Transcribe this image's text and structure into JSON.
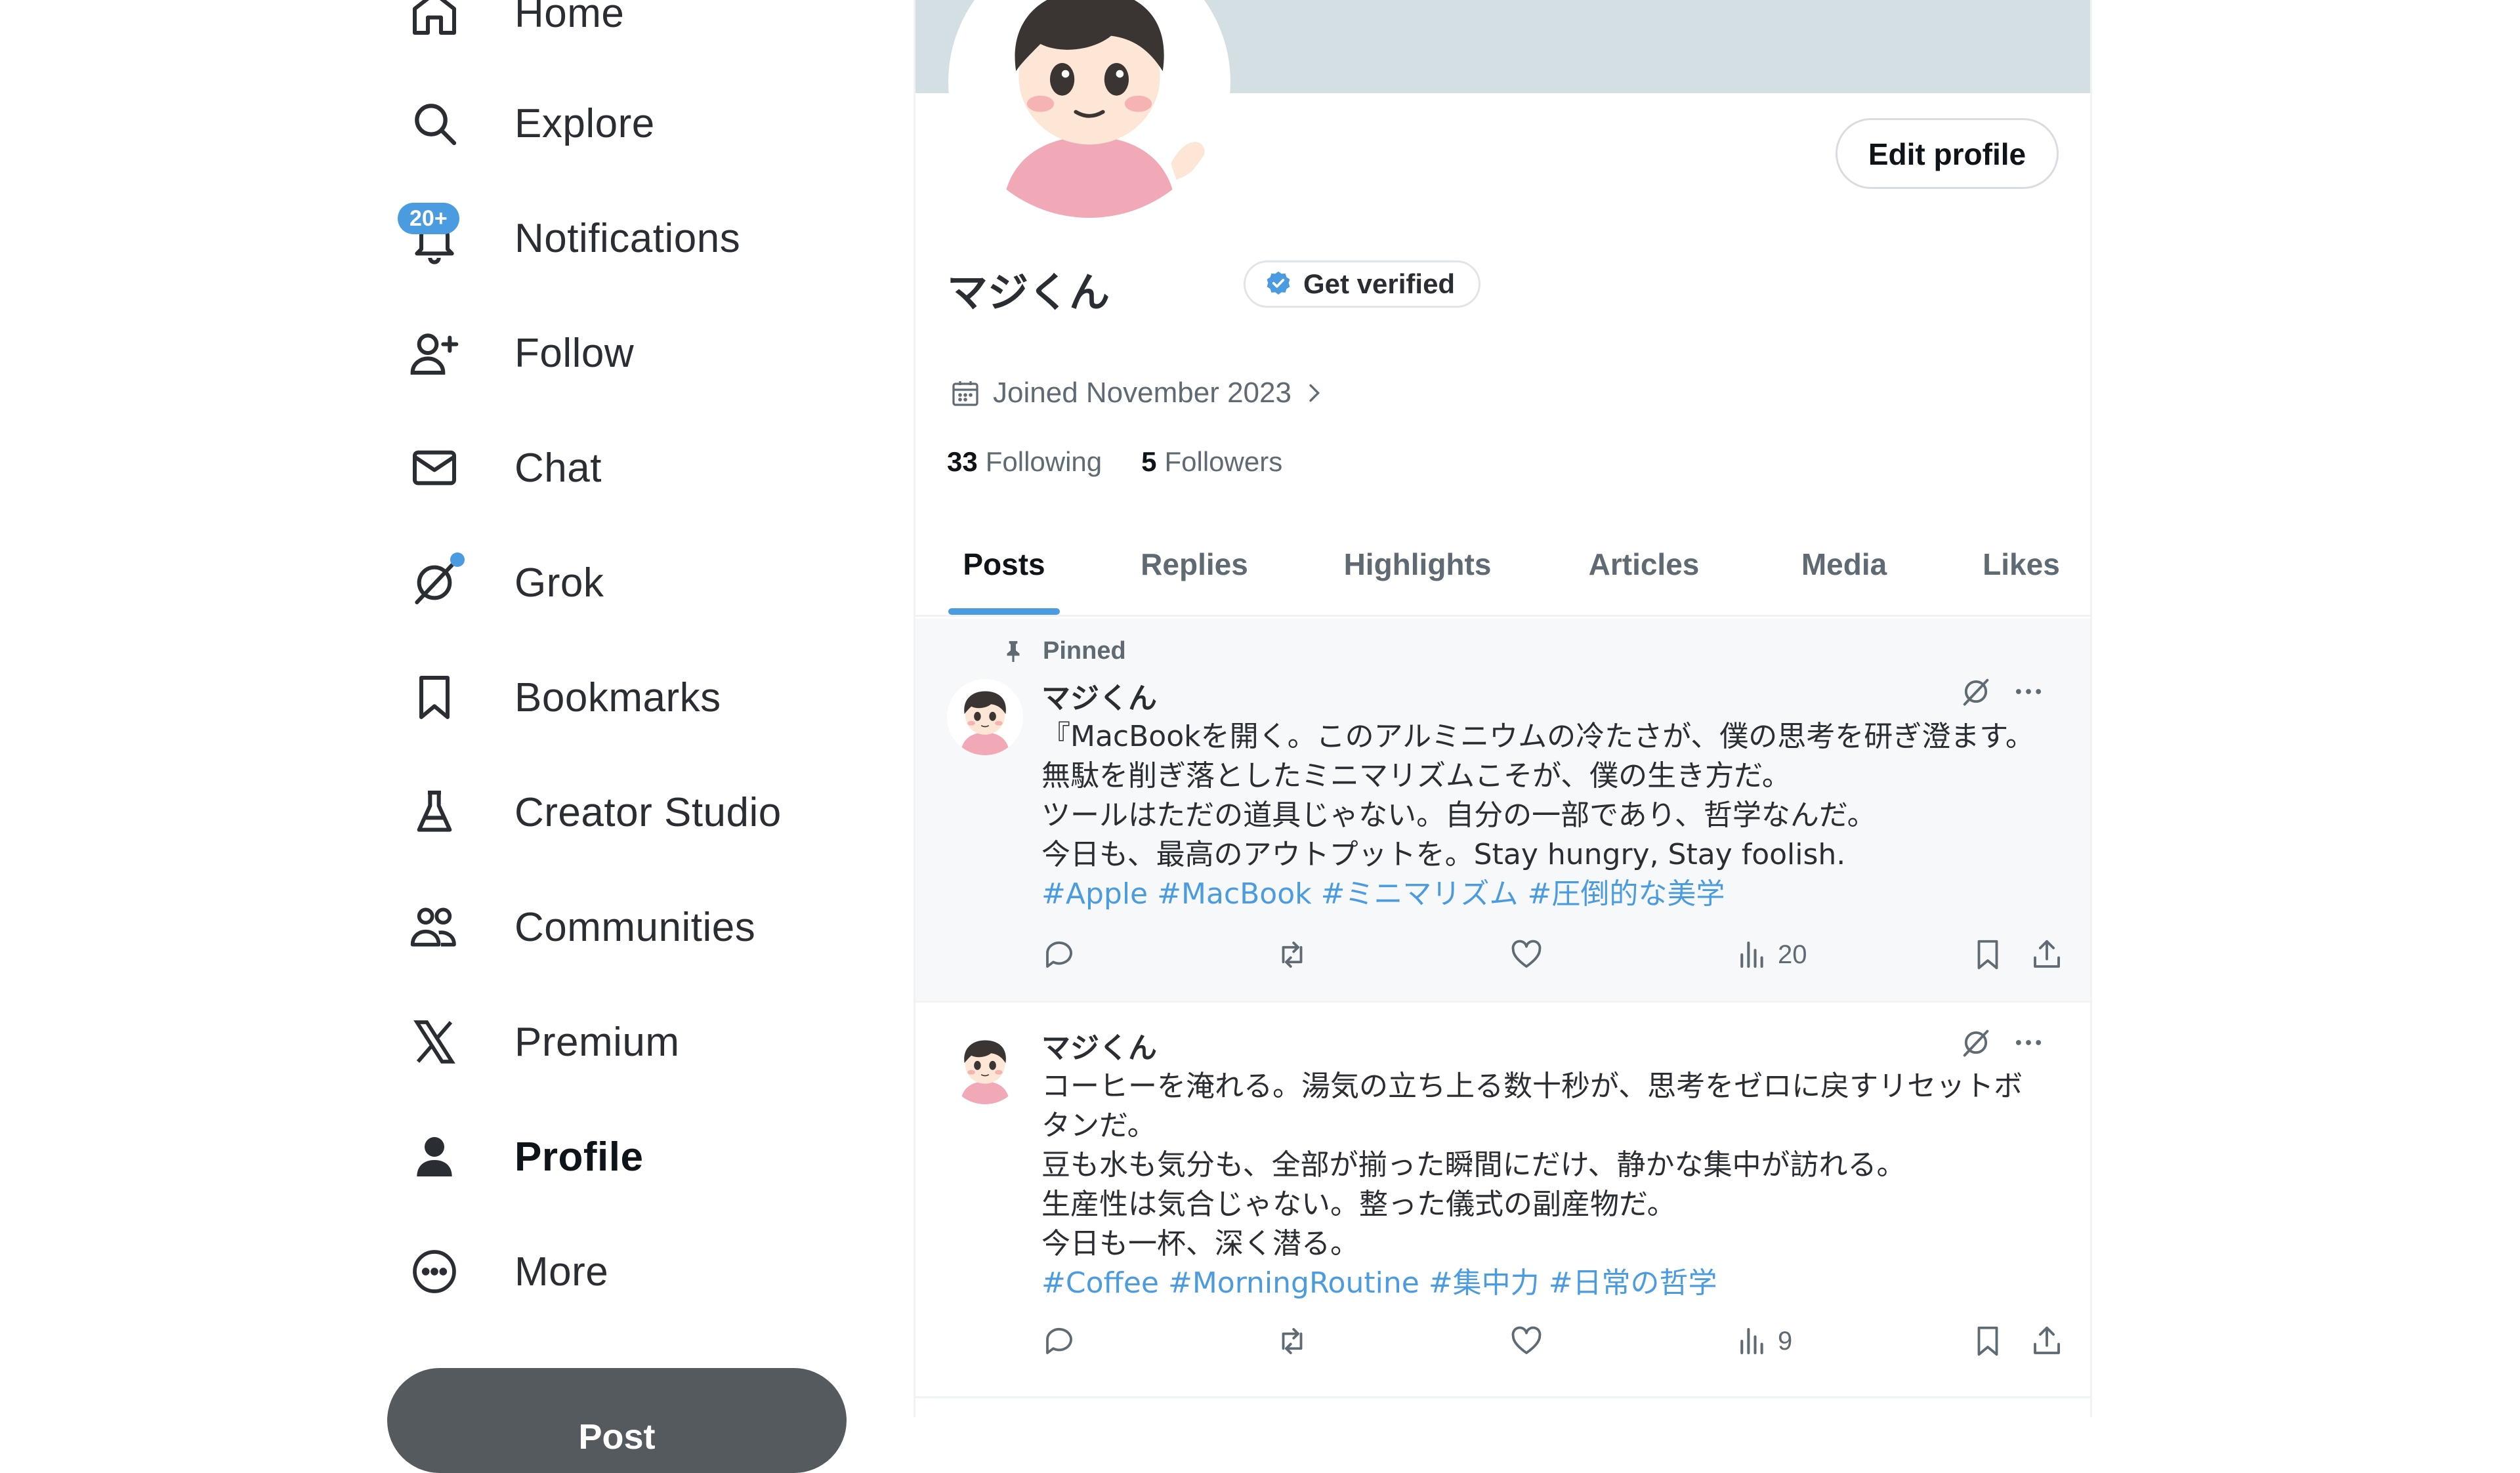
{
  "nav": {
    "home": "Home",
    "explore": "Explore",
    "notifications": "Notifications",
    "notifications_badge": "20+",
    "follow": "Follow",
    "chat": "Chat",
    "grok": "Grok",
    "bookmarks": "Bookmarks",
    "creator_studio": "Creator Studio",
    "communities": "Communities",
    "premium": "Premium",
    "profile": "Profile",
    "more": "More",
    "post_button": "Post"
  },
  "profile": {
    "edit_profile": "Edit profile",
    "display_name": "マジくん",
    "get_verified": "Get verified",
    "joined": "Joined November 2023",
    "following_count": "33",
    "following_label": "Following",
    "followers_count": "5",
    "followers_label": "Followers"
  },
  "tabs": {
    "posts": "Posts",
    "replies": "Replies",
    "highlights": "Highlights",
    "articles": "Articles",
    "media": "Media",
    "likes": "Likes",
    "active": "Posts"
  },
  "posts": [
    {
      "pinned_label": "Pinned",
      "author": "マジくん",
      "lines": [
        "『MacBookを開く。このアルミニウムの冷たさが、僕の思考を研ぎ澄ます。",
        "無駄を削ぎ落としたミニマリズムこそが、僕の生き方だ。",
        "ツールはただの道具じゃない。自分の一部であり、哲学なんだ。",
        "今日も、最高のアウトプットを。Stay hungry, Stay foolish."
      ],
      "hashtags": [
        "#Apple",
        "#MacBook",
        "#ミニマリズム",
        "#圧倒的な美学"
      ],
      "views": "20"
    },
    {
      "author": "マジくん",
      "lines": [
        "コーヒーを淹れる。湯気の立ち上る数十秒が、思考をゼロに戻すリセットボ",
        "タンだ。",
        "豆も水も気分も、全部が揃った瞬間にだけ、静かな集中が訪れる。",
        "生産性は気合じゃない。整った儀式の副産物だ。",
        "今日も一杯、深く潜る。"
      ],
      "hashtags": [
        "#Coffee",
        "#MorningRoutine",
        "#集中力",
        "#日常の哲学"
      ],
      "views": "9"
    }
  ],
  "colors": {
    "accent": "#4a9be0",
    "banner": "#d3dfe3",
    "pinned_bg": "#f7f8f9",
    "post_button": "#555a5e",
    "muted_text": "#5f6a73"
  },
  "icons": {
    "nav": [
      "home-icon",
      "search-icon",
      "bell-icon",
      "follow-icon",
      "mail-icon",
      "grok-icon",
      "bookmark-icon",
      "flask-icon",
      "communities-icon",
      "x-logo-icon",
      "person-icon",
      "more-circle-icon"
    ],
    "post_actions": [
      "reply-icon",
      "repost-icon",
      "like-icon",
      "views-icon",
      "bookmark-icon",
      "share-icon"
    ]
  }
}
